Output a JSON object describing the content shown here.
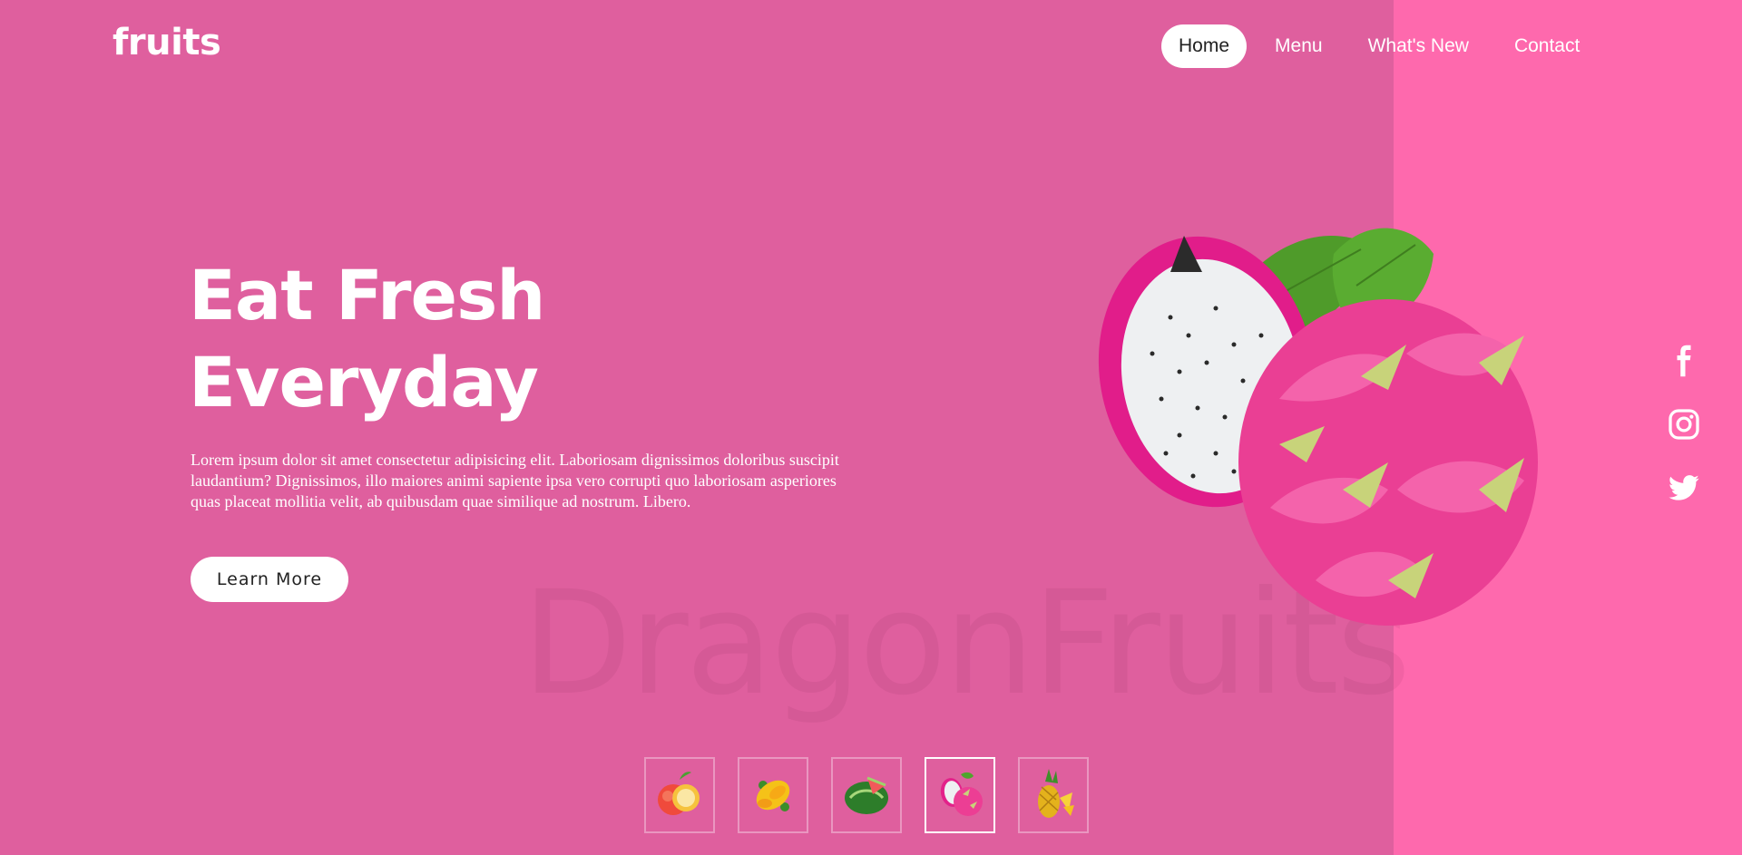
{
  "brand": {
    "logo": "fruits"
  },
  "nav": {
    "items": [
      {
        "label": "Home",
        "active": true
      },
      {
        "label": "Menu",
        "active": false
      },
      {
        "label": "What's New",
        "active": false
      },
      {
        "label": "Contact",
        "active": false
      }
    ]
  },
  "hero": {
    "title_line1": "Eat Fresh",
    "title_line2": "Everyday",
    "body": "Lorem ipsum dolor sit amet consectetur adipisicing elit. Laboriosam dignissimos doloribus suscipit laudantium? Dignissimos, illo maiores animi sapiente ipsa vero corrupti quo laboriosam asperiores quas placeat mollitia velit, ab quibusdam quae similique ad nostrum. Libero.",
    "cta_label": "Learn More",
    "background_word": "DragonFruits"
  },
  "social": {
    "icons": [
      "facebook-icon",
      "instagram-icon",
      "twitter-icon"
    ]
  },
  "thumbnails": {
    "items": [
      {
        "icon": "apple-icon",
        "active": false
      },
      {
        "icon": "mango-icon",
        "active": false
      },
      {
        "icon": "watermelon-icon",
        "active": false
      },
      {
        "icon": "dragonfruit-icon",
        "active": true
      },
      {
        "icon": "pineapple-icon",
        "active": false
      }
    ]
  },
  "colors": {
    "background": "#df5f9e",
    "right_panel": "#fe69ad",
    "text": "#ffffff",
    "button_bg": "#ffffff",
    "button_text": "#222222"
  }
}
